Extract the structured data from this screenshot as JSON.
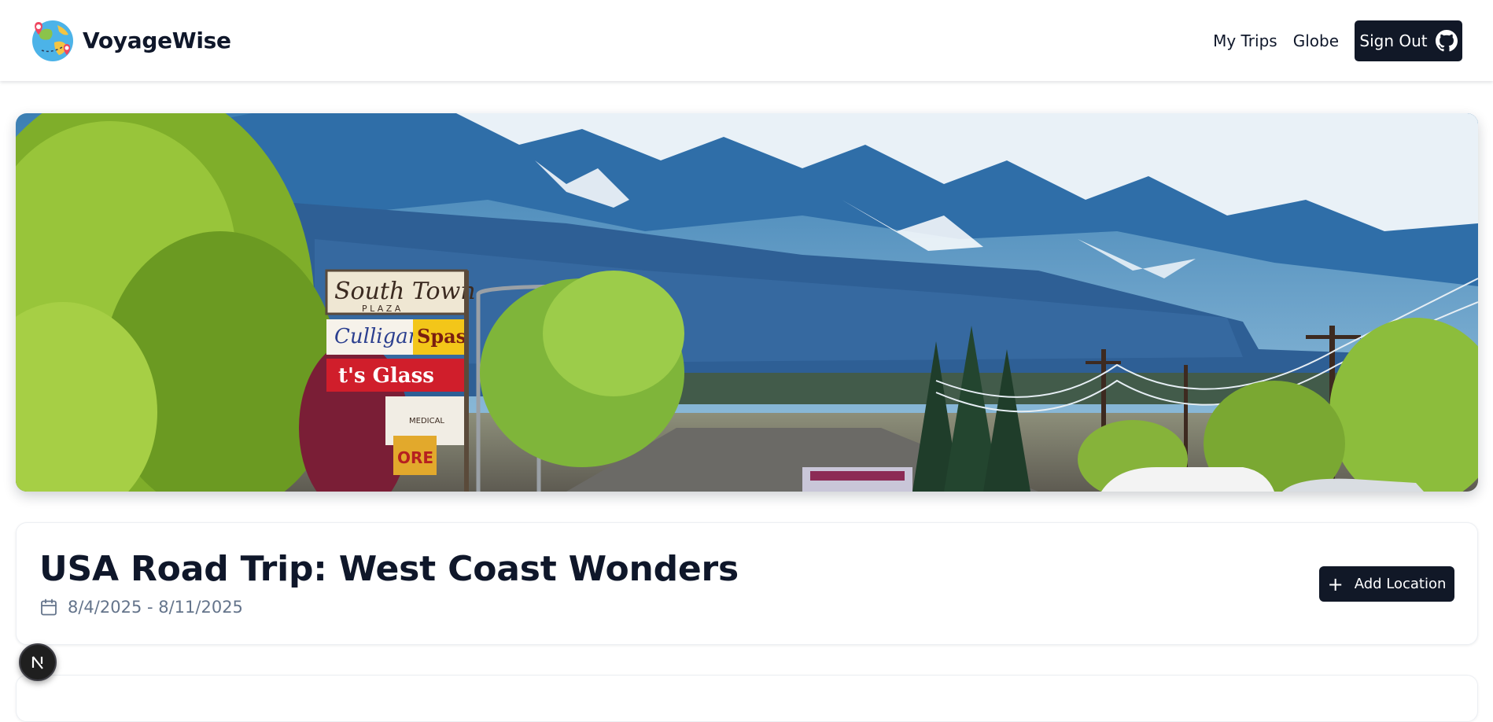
{
  "brand": {
    "name": "VoyageWise",
    "logo_icon": "globe-with-pins-icon"
  },
  "nav": {
    "links": [
      {
        "label": "My Trips"
      },
      {
        "label": "Globe"
      }
    ],
    "sign_out": {
      "label": "Sign Out",
      "icon": "github-icon"
    }
  },
  "hero": {
    "image": "road-with-mountains-photo",
    "sign_text": "South Town",
    "sign_sub": "P L A Z A",
    "sign_lines": [
      "Culligan",
      "Spas",
      "t's Glass",
      "ORE",
      "MEDICAL"
    ]
  },
  "trip": {
    "title": "USA Road Trip: West Coast Wonders",
    "dates": "8/4/2025 - 8/11/2025",
    "dates_icon": "calendar-icon",
    "add_location_label": "Add Location",
    "add_location_icon": "plus-icon"
  },
  "dev_badge": {
    "label": "N"
  },
  "colors": {
    "primary": "#111827",
    "text": "#0f172a",
    "muted": "#64748b"
  }
}
